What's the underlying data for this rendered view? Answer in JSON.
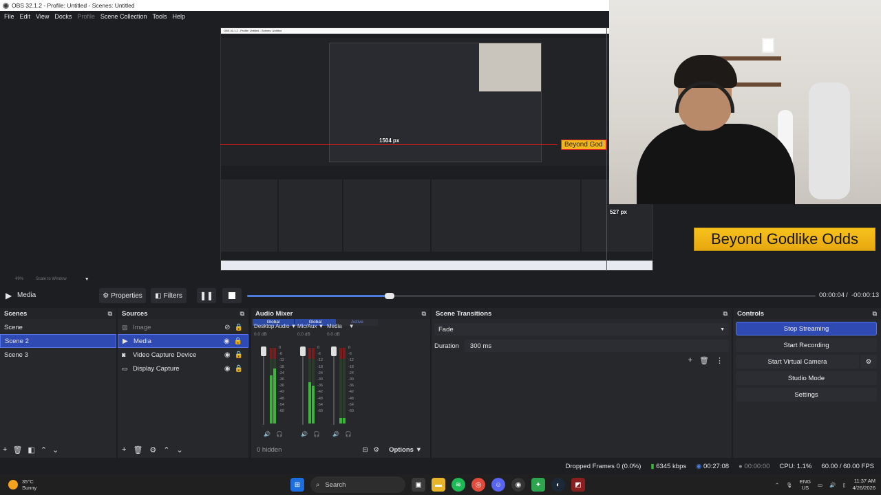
{
  "window": {
    "title": "OBS 32.1.2 - Profile: Untitled - Scenes: Untitled"
  },
  "menu": [
    "File",
    "Edit",
    "View",
    "Docks",
    "Profile",
    "Scene Collection",
    "Tools",
    "Help"
  ],
  "preview": {
    "measure_h": "1504 px",
    "measure_v": "527 px",
    "overlay_text": "Beyond Godlike Odds",
    "overlay_text_small": "Beyond God",
    "zoom_value": "49%",
    "zoom_mode": "Scale to Window"
  },
  "media": {
    "source_name": "Media",
    "properties_label": "Properties",
    "filters_label": "Filters",
    "elapsed": "00:00:04",
    "separator": "/",
    "remaining": "-00:00:13",
    "progress": 0.25
  },
  "scenes": {
    "title": "Scenes",
    "items": [
      "Scene",
      "Scene 2",
      "Scene 3"
    ],
    "selected_index": 1
  },
  "sources": {
    "title": "Sources",
    "items": [
      {
        "name": "Image",
        "icon": "image-icon",
        "visible": false
      },
      {
        "name": "Media",
        "icon": "play-icon",
        "visible": true
      },
      {
        "name": "Video Capture Device",
        "icon": "camera-icon",
        "visible": true
      },
      {
        "name": "Display Capture",
        "icon": "monitor-icon",
        "visible": true
      }
    ],
    "selected_index": 1
  },
  "mixer": {
    "title": "Audio Mixer",
    "tabs": [
      "Global",
      "Global",
      "Active"
    ],
    "channels": [
      {
        "name": "Desktop Audio",
        "db": "0.0 dB"
      },
      {
        "name": "Mic/Aux",
        "db": "0.0 dB"
      },
      {
        "name": "Media",
        "db": "0.0 dB"
      }
    ],
    "scale": [
      "0",
      "-6",
      "-12",
      "-18",
      "-24",
      "-30",
      "-36",
      "-42",
      "-48",
      "-54",
      "-60"
    ],
    "hidden_label": "0 hidden",
    "options_label": "Options"
  },
  "transitions": {
    "title": "Scene Transitions",
    "selected": "Fade",
    "duration_label": "Duration",
    "duration_value": "300 ms"
  },
  "controls": {
    "title": "Controls",
    "stop_streaming": "Stop Streaming",
    "start_recording": "Start Recording",
    "start_virtual_camera": "Start Virtual Camera",
    "studio_mode": "Studio Mode",
    "settings": "Settings"
  },
  "status": {
    "dropped_frames": "Dropped Frames 0 (0.0%)",
    "bitrate": "6345 kbps",
    "stream_time": "00:27:08",
    "record_time": "00:00:00",
    "cpu": "CPU: 1.1%",
    "fps": "60.00 / 60.00 FPS"
  },
  "taskbar": {
    "temperature": "35°C",
    "condition": "Sunny",
    "search_placeholder": "Search",
    "lang": "ENG",
    "region": "US",
    "time": "11:37 AM",
    "date": "4/26/2026"
  },
  "colors": {
    "accent_blue": "#2f4bb3",
    "overlay_gold": "#f2b51b",
    "guide_red": "#e01818"
  }
}
